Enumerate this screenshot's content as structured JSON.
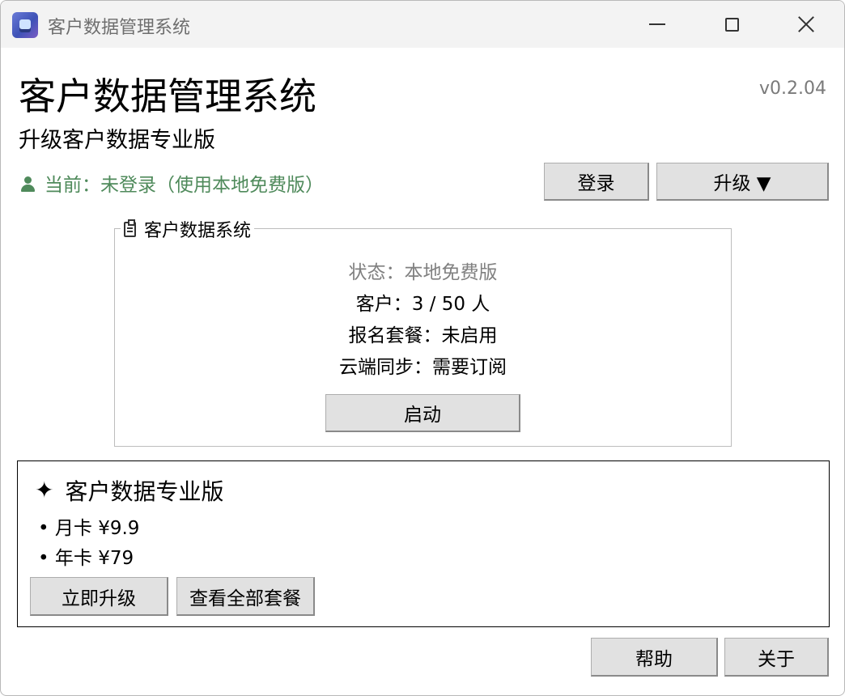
{
  "window": {
    "title": "客户数据管理系统"
  },
  "header": {
    "title": "客户数据管理系统",
    "version": "v0.2.04",
    "subtitle": "升级客户数据专业版",
    "user_status": "当前：未登录（使用本地免费版）",
    "login_label": "登录",
    "upgrade_label": "升级 ▼"
  },
  "system_group": {
    "legend": "客户数据系统",
    "status": "状态：本地免费版",
    "customers": "客户：3 / 50 人",
    "package": "报名套餐：未启用",
    "sync": "云端同步：需要订阅",
    "start_label": "启动"
  },
  "pro": {
    "title": "客户数据专业版",
    "monthly": "• 月卡 ¥9.9",
    "yearly": "• 年卡 ¥79",
    "upgrade_now_label": "立即升级",
    "view_plans_label": "查看全部套餐"
  },
  "footer": {
    "help_label": "帮助",
    "about_label": "关于"
  },
  "colors": {
    "status_green": "#4f8a5b",
    "muted_gray": "#808080",
    "button_bg": "#e1e1e1"
  }
}
